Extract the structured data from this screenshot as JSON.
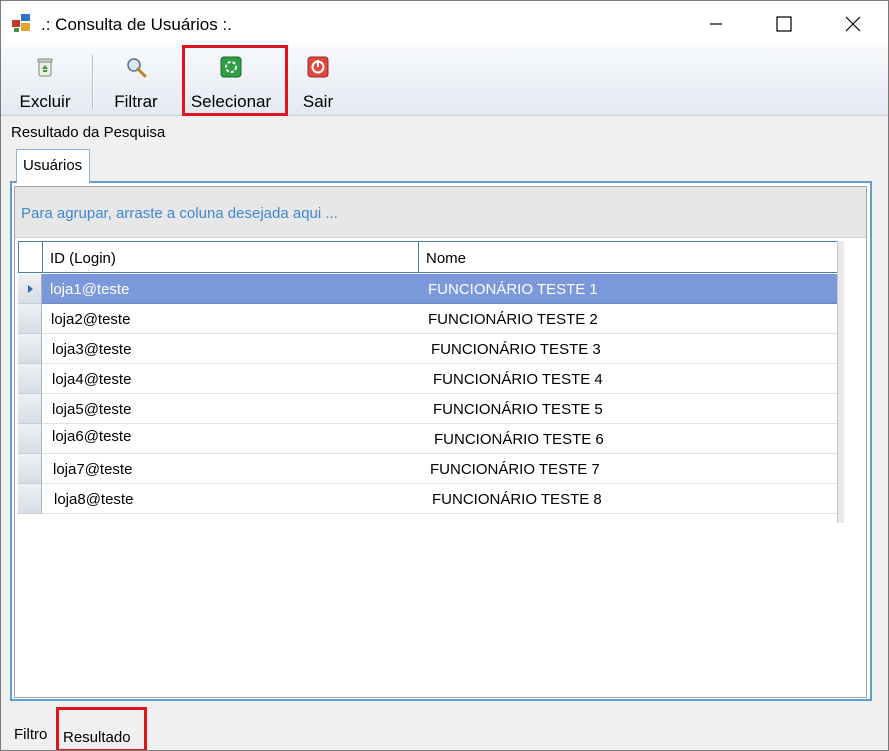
{
  "window": {
    "title": ".: Consulta de Usuários :.",
    "controls": [
      "minimize-icon",
      "maximize-icon",
      "close-icon"
    ]
  },
  "toolbar": {
    "buttons": [
      {
        "label": "Excluir",
        "icon": "recycle-bin-icon"
      },
      {
        "label": "Filtrar",
        "icon": "magnifier-icon"
      },
      {
        "label": "Selecionar",
        "icon": "select-icon",
        "highlighted": true
      },
      {
        "label": "Sair",
        "icon": "power-icon"
      }
    ]
  },
  "content": {
    "group_title": "Resultado da Pesquisa",
    "tab_label": "Usuários",
    "group_hint": "Para agrupar, arraste a coluna desejada aqui ..."
  },
  "grid": {
    "columns": [
      "ID (Login)",
      "Nome"
    ],
    "rows": [
      {
        "id": "loja1@teste",
        "nome": "FUNCIONÁRIO TESTE 1",
        "selected": true
      },
      {
        "id": "loja2@teste",
        "nome": "FUNCIONÁRIO TESTE 2"
      },
      {
        "id": "loja3@teste",
        "nome": "FUNCIONÁRIO TESTE 3"
      },
      {
        "id": "loja4@teste",
        "nome": "FUNCIONÁRIO TESTE 4"
      },
      {
        "id": "loja5@teste",
        "nome": "FUNCIONÁRIO TESTE 5"
      },
      {
        "id": "loja6@teste",
        "nome": "FUNCIONÁRIO TESTE 6"
      },
      {
        "id": "loja7@teste",
        "nome": "FUNCIONÁRIO TESTE 7"
      },
      {
        "id": "loja8@teste",
        "nome": "FUNCIONÁRIO TESTE 8"
      }
    ]
  },
  "bottom_tabs": [
    {
      "label": "Filtro"
    },
    {
      "label": "Resultado",
      "active": true,
      "highlighted": true
    }
  ],
  "colors": {
    "selected_row": "#7b98db",
    "highlight_box": "#e0141e",
    "group_hint_text": "#3e88cf",
    "tab_border": "#5f9ecf"
  }
}
